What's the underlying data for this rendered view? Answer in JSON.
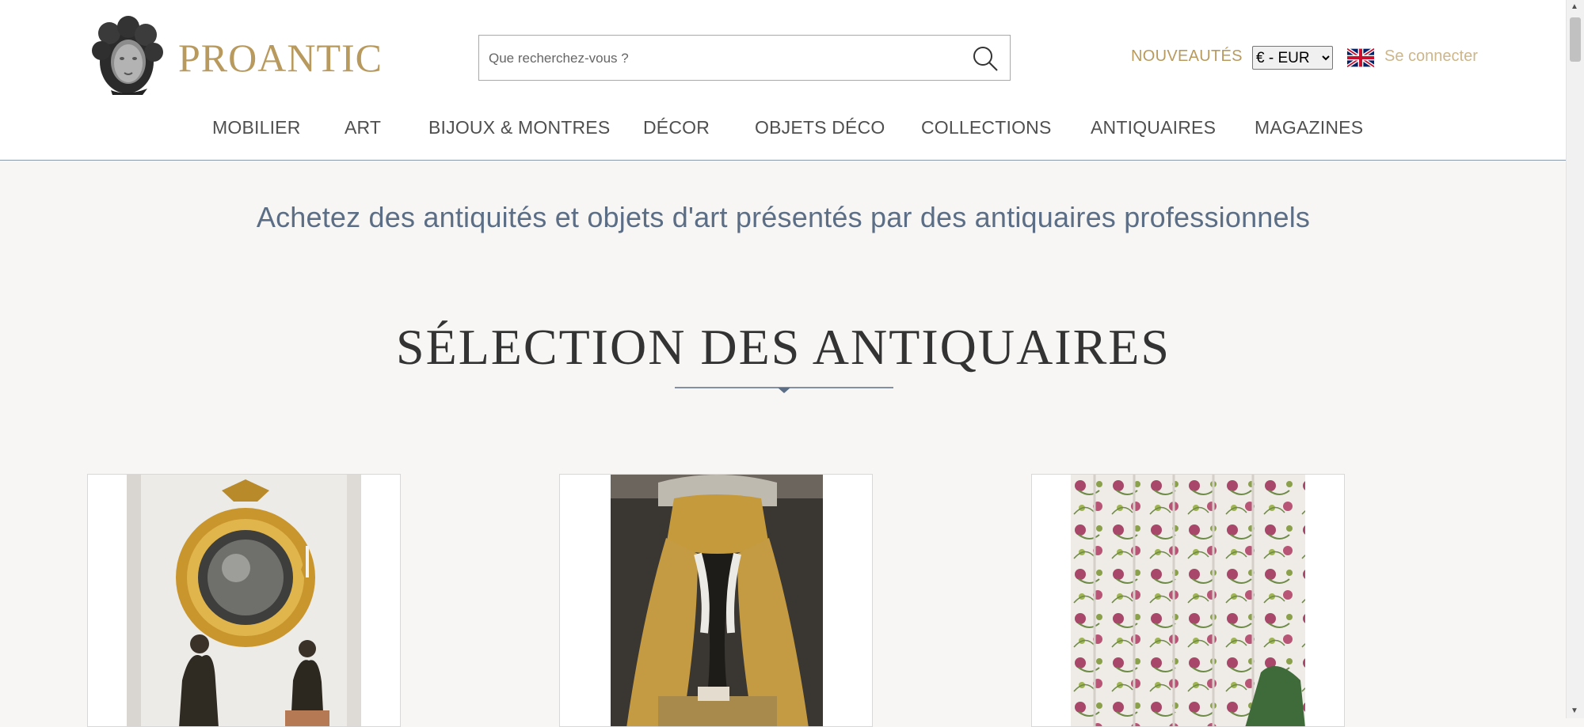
{
  "header": {
    "logo_text": "PROANTIC",
    "search": {
      "placeholder": "Que recherchez-vous ?",
      "value": ""
    },
    "nouveautes_label": "NOUVEAUTÉS",
    "currency": {
      "selected": "€ - EUR",
      "options": [
        "€ - EUR"
      ]
    },
    "language_flag": "uk-flag-icon",
    "login_label": "Se connecter"
  },
  "nav": {
    "items": [
      {
        "label": "MOBILIER"
      },
      {
        "label": "ART"
      },
      {
        "label": "BIJOUX & MONTRES"
      },
      {
        "label": "DÉCOR"
      },
      {
        "label": "OBJETS DÉCO"
      },
      {
        "label": "COLLECTIONS"
      },
      {
        "label": "ANTIQUAIRES"
      },
      {
        "label": "MAGAZINES"
      }
    ]
  },
  "main": {
    "tagline": "Achetez des antiquités et objets d'art présentés par des antiquaires professionnels",
    "section_title": "SÉLECTION DES ANTIQUAIRES",
    "cards": [
      {
        "image": "gilt-mirror-and-bronze-figures"
      },
      {
        "image": "canopy-bed-gold-drapes"
      },
      {
        "image": "floral-printed-curtains"
      }
    ]
  },
  "colors": {
    "brand_gold": "#b99a5e",
    "login_gold": "#cdb68a",
    "tagline_blue": "#5b6e85",
    "background": "#f7f6f4"
  }
}
